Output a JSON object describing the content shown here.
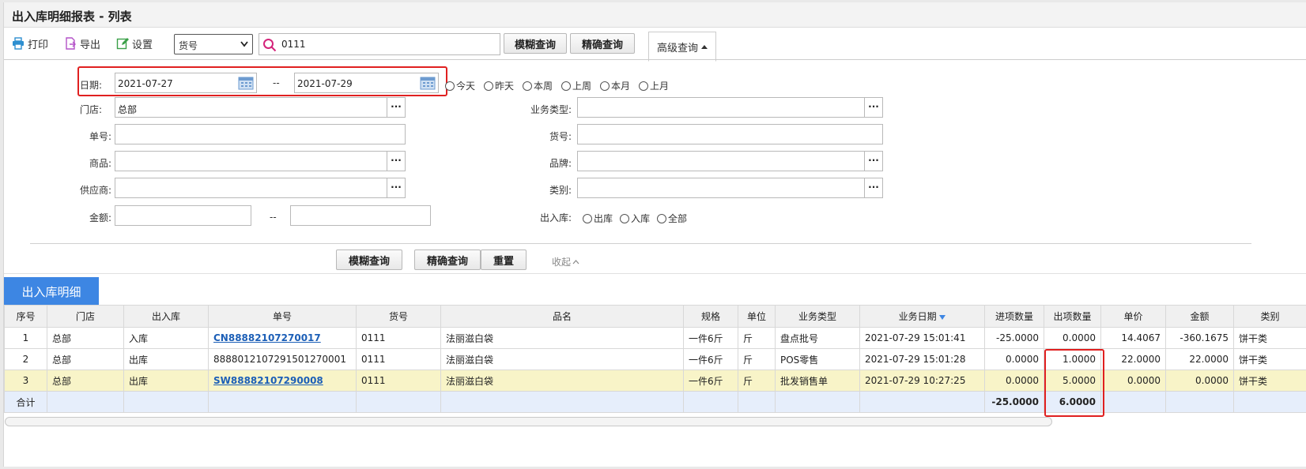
{
  "title": "出入库明细报表 - 列表",
  "toolbar": {
    "print": "打印",
    "export": "导出",
    "settings": "设置",
    "field_select": "货号",
    "search_value": "0111",
    "fuzzy_query": "模糊查询",
    "exact_query": "精确查询",
    "advanced_query": "高级查询"
  },
  "filters": {
    "date_label": "日期:",
    "date_from": "2021-07-27",
    "date_sep": "--",
    "date_to": "2021-07-29",
    "quick_dates": [
      "今天",
      "昨天",
      "本周",
      "上周",
      "本月",
      "上月"
    ],
    "store_label": "门店:",
    "store_value": "总部",
    "biz_type_label": "业务类型:",
    "order_no_label": "单号:",
    "item_no_label": "货号:",
    "product_label": "商品:",
    "brand_label": "品牌:",
    "supplier_label": "供应商:",
    "category_label": "类别:",
    "amount_label": "金额:",
    "amount_sep": "--",
    "inout_label": "出入库:",
    "inout_options": [
      "出库",
      "入库",
      "全部"
    ],
    "fuzzy_query": "模糊查询",
    "exact_query": "精确查询",
    "reset": "重置",
    "collapse": "收起"
  },
  "section_tab": "出入库明细",
  "table": {
    "headers": [
      "序号",
      "门店",
      "出入库",
      "单号",
      "货号",
      "品名",
      "规格",
      "单位",
      "业务类型",
      "业务日期",
      "进项数量",
      "出项数量",
      "单价",
      "金额",
      "类别"
    ],
    "rows": [
      [
        "1",
        "总部",
        "入库",
        "CN88882107270017",
        "0111",
        "法丽滋白袋",
        "一件6斤",
        "斤",
        "盘点批号",
        "2021-07-29 15:01:41",
        "-25.0000",
        "0.0000",
        "14.4067",
        "-360.1675",
        "饼干类"
      ],
      [
        "2",
        "总部",
        "出库",
        "888801210729150127000​1",
        "0111",
        "法丽滋白袋",
        "一件6斤",
        "斤",
        "POS零售",
        "2021-07-29 15:01:28",
        "0.0000",
        "1.0000",
        "22.0000",
        "22.0000",
        "饼干类"
      ],
      [
        "3",
        "总部",
        "出库",
        "SW88882107290008",
        "0111",
        "法丽滋白袋",
        "一件6斤",
        "斤",
        "批发销售单",
        "2021-07-29 10:27:25",
        "0.0000",
        "5.0000",
        "0.0000",
        "0.0000",
        "饼干类"
      ]
    ],
    "sum_label": "合计",
    "sum_in": "-25.0000",
    "sum_out": "6.0000"
  },
  "colors": {
    "accent": "#3d86e3",
    "highlight_row": "#f8f4c8",
    "red_box": "#e02020",
    "link": "#1c5fb7"
  }
}
